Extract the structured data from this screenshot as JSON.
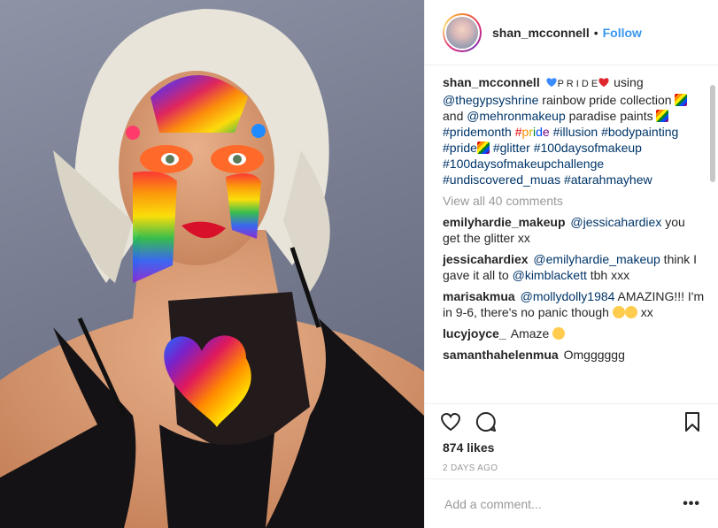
{
  "post": {
    "username": "shan_mcconnell",
    "follow_separator": "•",
    "follow_label": "Follow",
    "caption": {
      "user": "shan_mcconnell",
      "title_text": "P R I D E",
      "p1": " using ",
      "m1": "@thegypsyshrine",
      "p2": " rainbow pride collection ",
      "p3": " and ",
      "m2": "@mehronmakeup",
      "p4": " paradise paints ",
      "h1": "#pridemonth",
      "h2_letters": [
        "p",
        "r",
        "i",
        "d",
        "e"
      ],
      "h3": "#illusion",
      "h4": "#bodypainting",
      "h5": "#pride",
      "h6": "#glitter",
      "h7": "#100daysofmakeup",
      "h8": "#100daysofmakeupchallenge",
      "h9": "#undiscovered_muas",
      "h10": "#atarahmayhew"
    },
    "view_all": "View all 40 comments",
    "comments": [
      {
        "user": "emilyhardie_makeup",
        "mention": "@jessicahardiex",
        "text": " you get the glitter xx"
      },
      {
        "user": "jessicahardiex",
        "mention": "@emilyhardie_makeup",
        "text": " think I gave it all to ",
        "mention2": "@kimblackett",
        "text2": " tbh xxx"
      },
      {
        "user": "marisakmua",
        "mention": "@mollydolly1984",
        "text": " AMAZING!!! I'm in 9-6, there's no panic though ",
        "text2": " xx"
      },
      {
        "user": "lucyjoyce_",
        "text": "Amaze "
      },
      {
        "user": "samanthahelenmua",
        "text": "Omgggggg"
      }
    ],
    "likes": "874 likes",
    "time": "2 DAYS AGO",
    "add_comment_placeholder": "Add a comment...",
    "more_label": "•••",
    "icons": {
      "like": "heart-icon",
      "comment": "comment-icon",
      "save": "bookmark-icon",
      "more": "more-options-icon"
    },
    "colors": {
      "link": "#3897f0",
      "hashtag": "#003569",
      "muted": "#999999",
      "text": "#262626"
    }
  }
}
